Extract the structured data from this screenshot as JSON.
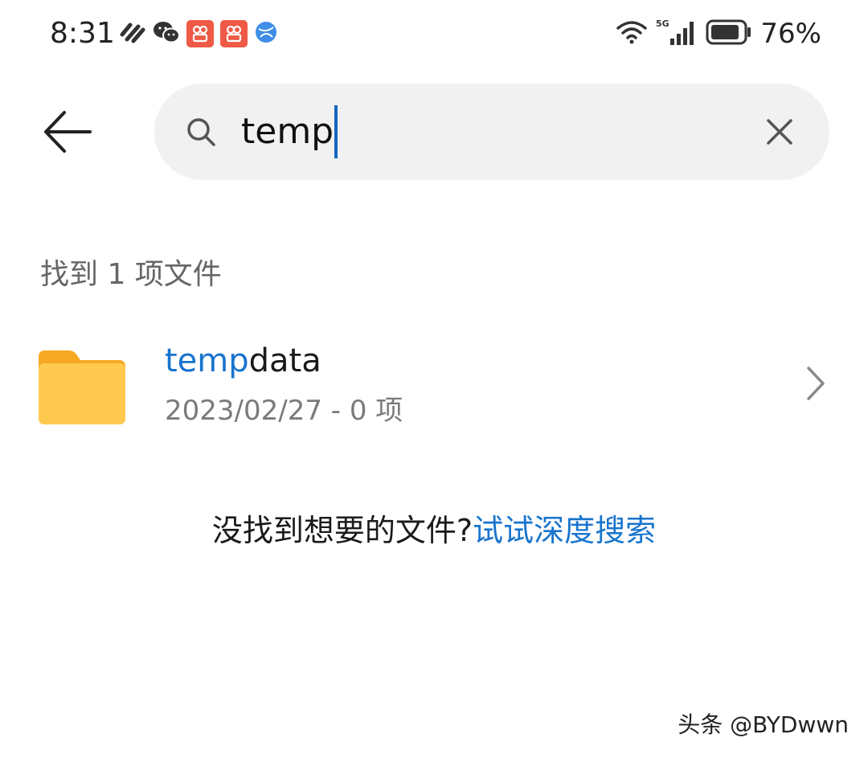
{
  "status_bar": {
    "time": "8:31",
    "battery_percent": "76%",
    "network": "5G",
    "left_icons": [
      "link-icon",
      "wechat-icon",
      "app-notification-icon",
      "app-notification-icon",
      "browser-icon"
    ],
    "right_icons": [
      "wifi-icon",
      "signal-icon",
      "battery-icon"
    ]
  },
  "search": {
    "query": "temp",
    "back_icon": "back-arrow-icon",
    "search_icon": "search-icon",
    "clear_icon": "close-icon"
  },
  "results": {
    "count_label": "找到 1 项文件",
    "items": [
      {
        "icon": "folder-icon",
        "name_highlight": "temp",
        "name_rest": "data",
        "meta": "2023/02/27 - 0 项"
      }
    ]
  },
  "deep_search": {
    "question": "没找到想要的文件?",
    "link": "试试深度搜索"
  },
  "watermark": "头条 @BYDwwn",
  "colors": {
    "accent": "#1874cd",
    "folder": "#ffc94f",
    "folder_tab": "#f7a823",
    "search_bg": "#f1f1f1"
  }
}
